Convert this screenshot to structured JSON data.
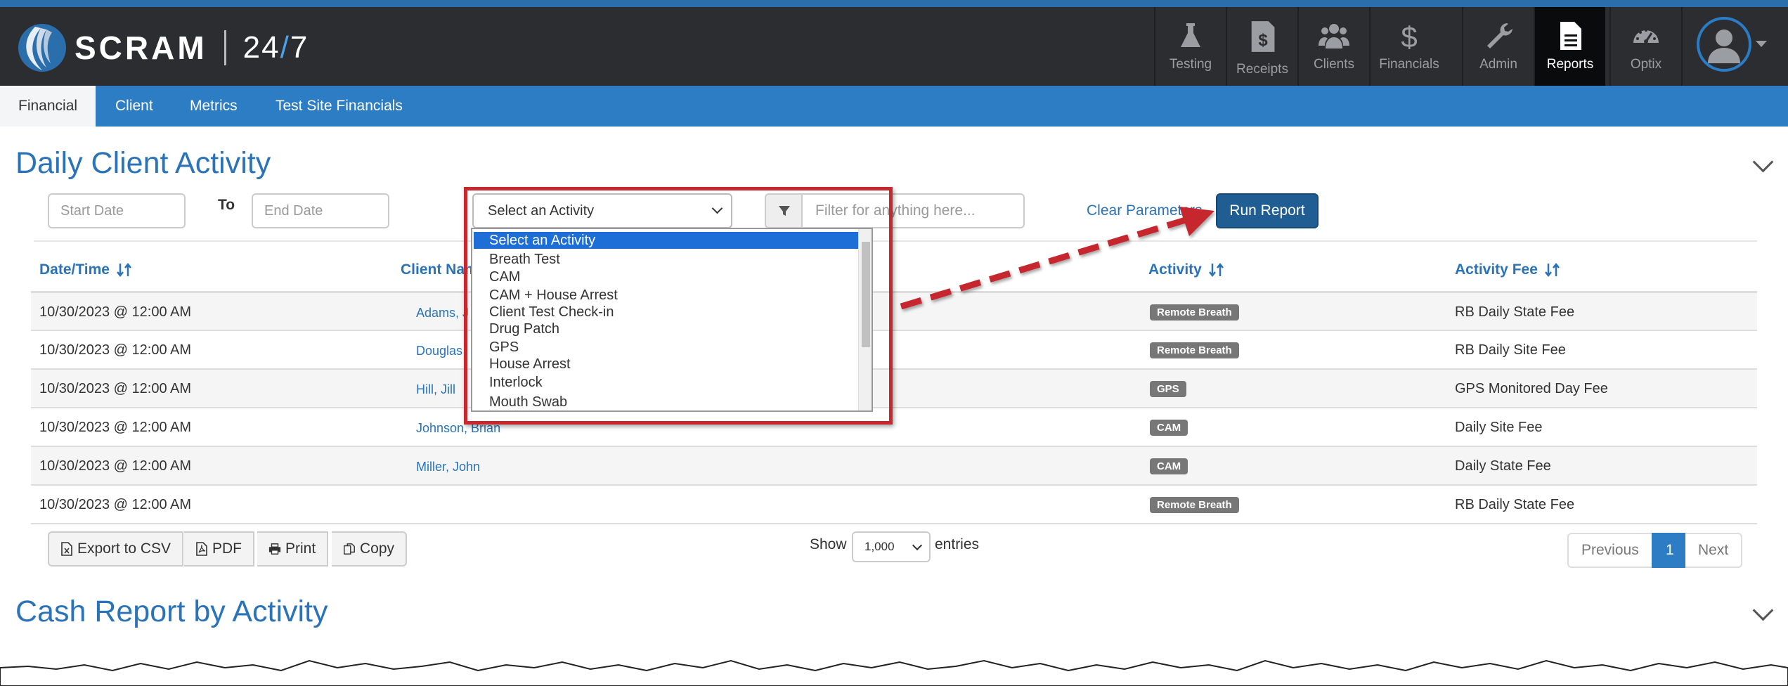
{
  "brand": {
    "name": "SCRAM",
    "suffix_left": "24",
    "suffix_slash": "/",
    "suffix_right": "7"
  },
  "nav": [
    {
      "label": "Testing",
      "icon": "flask-icon"
    },
    {
      "label": "Receipts",
      "icon": "receipt-icon"
    },
    {
      "label": "Clients",
      "icon": "users-icon"
    },
    {
      "label": "Financials",
      "icon": "dollar-icon"
    },
    {
      "label": "Admin",
      "icon": "wrench-icon"
    },
    {
      "label": "Reports",
      "icon": "document-icon",
      "active": true
    },
    {
      "label": "Optix",
      "icon": "dashboard-icon"
    }
  ],
  "subtabs": [
    "Financial",
    "Client",
    "Metrics",
    "Test Site Financials"
  ],
  "section1": {
    "title": "Daily Client Activity",
    "start_placeholder": "Start Date",
    "to_label": "To",
    "end_placeholder": "End Date",
    "activity_select": "Select an Activity",
    "filter_placeholder": "Filter for anything here...",
    "clear_label": "Clear Parameters",
    "run_label": "Run Report"
  },
  "table": {
    "headers": [
      "Date/Time",
      "Client Name",
      "Activity",
      "Activity Fee"
    ],
    "rows": [
      {
        "date": "10/30/2023 @ 12:00 AM",
        "client": "Adams, J",
        "activity": "Remote Breath",
        "fee": "RB Daily State Fee"
      },
      {
        "date": "10/30/2023 @ 12:00 AM",
        "client": "Douglas",
        "activity": "Remote Breath",
        "fee": "RB Daily Site Fee"
      },
      {
        "date": "10/30/2023 @ 12:00 AM",
        "client": "Hill, Jill",
        "activity": "GPS",
        "fee": "GPS Monitored Day Fee"
      },
      {
        "date": "10/30/2023 @ 12:00 AM",
        "client": "Johnson, Brian",
        "activity": "CAM",
        "fee": "Daily Site Fee"
      },
      {
        "date": "10/30/2023 @ 12:00 AM",
        "client": "Miller, John",
        "activity": "CAM",
        "fee": "Daily State Fee"
      },
      {
        "date": "10/30/2023 @ 12:00 AM",
        "client": "",
        "activity": "Remote Breath",
        "fee": "RB Daily State Fee"
      }
    ]
  },
  "export": {
    "csv": "Export to CSV",
    "pdf": "PDF",
    "print": "Print",
    "copy": "Copy"
  },
  "paging": {
    "show": "Show",
    "per_page": "1,000",
    "entries": "entries",
    "previous": "Previous",
    "current": "1",
    "next": "Next"
  },
  "dropdown_options": [
    "Select an Activity",
    "Breath Test",
    "CAM",
    "CAM + House Arrest",
    "Client Test Check-in",
    "Drug Patch",
    "GPS",
    "House Arrest",
    "Interlock",
    "Mouth Swab"
  ],
  "section2": {
    "title": "Cash Report by Activity"
  },
  "colors": {
    "header_bg": "#2c2d30",
    "subnav_bg": "#2d7dc4",
    "title_blue": "#2a73b8",
    "run_btn": "#1f5d93",
    "highlight_red": "#c6282e",
    "badge_gray": "#777777"
  }
}
